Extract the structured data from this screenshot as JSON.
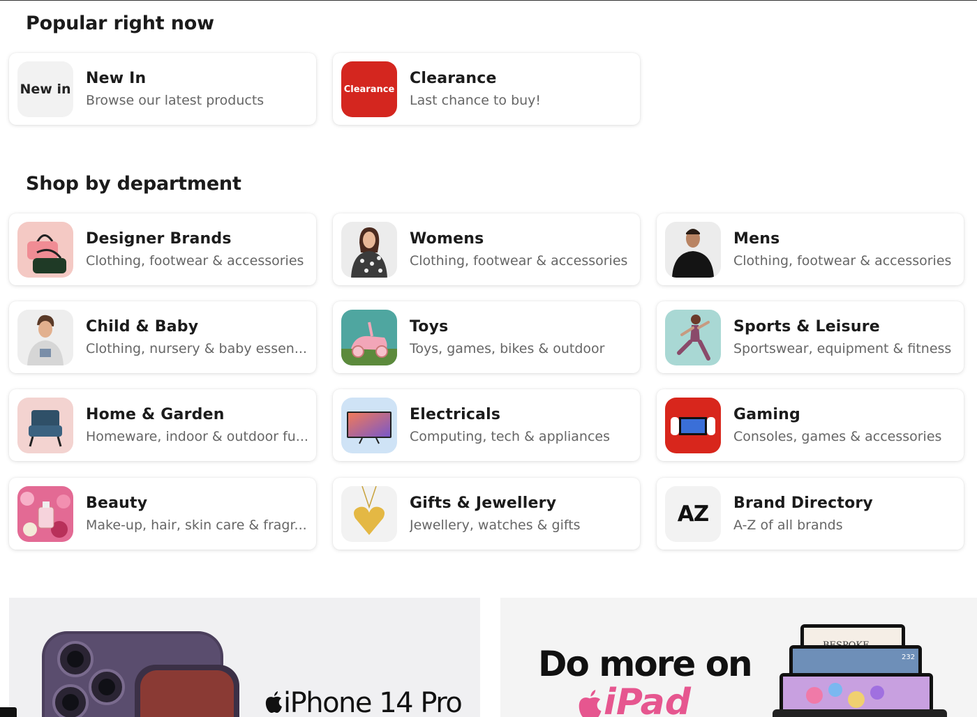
{
  "popular": {
    "title": "Popular right now",
    "items": [
      {
        "name": "New In",
        "desc": "Browse our latest products",
        "thumb_label": "New in"
      },
      {
        "name": "Clearance",
        "desc": "Last chance to buy!",
        "thumb_label": "Clearance"
      }
    ]
  },
  "departments": {
    "title": "Shop by department",
    "items": [
      {
        "name": "Designer Brands",
        "desc": "Clothing, footwear & accessories",
        "icon": "handbag-icon"
      },
      {
        "name": "Womens",
        "desc": "Clothing, footwear & accessories",
        "icon": "woman-model-icon"
      },
      {
        "name": "Mens",
        "desc": "Clothing, footwear & accessories",
        "icon": "man-model-icon"
      },
      {
        "name": "Child & Baby",
        "desc": "Clothing, nursery & baby essen...",
        "icon": "child-model-icon"
      },
      {
        "name": "Toys",
        "desc": "Toys, games, bikes & outdoor",
        "icon": "ride-on-toy-icon"
      },
      {
        "name": "Sports & Leisure",
        "desc": "Sportswear, equipment & fitness",
        "icon": "runner-icon"
      },
      {
        "name": "Home & Garden",
        "desc": "Homeware, indoor & outdoor fu...",
        "icon": "armchair-icon"
      },
      {
        "name": "Electricals",
        "desc": "Computing, tech & appliances",
        "icon": "tv-icon"
      },
      {
        "name": "Gaming",
        "desc": "Consoles, games & accessories",
        "icon": "game-console-icon"
      },
      {
        "name": "Beauty",
        "desc": "Make-up, hair, skin care & fragr...",
        "icon": "perfume-flowers-icon"
      },
      {
        "name": "Gifts & Jewellery",
        "desc": "Jewellery, watches & gifts",
        "icon": "heart-pendant-icon"
      },
      {
        "name": "Brand Directory",
        "desc": "A-Z of all brands",
        "thumb_label": "AZ"
      }
    ]
  },
  "banners": {
    "iphone": {
      "text": "iPhone 14 Pro"
    },
    "ipad": {
      "line1": "Do more on",
      "line2": "iPad",
      "screen_text": "BESPOKE",
      "badge": "232"
    }
  },
  "colors": {
    "clearance_red": "#d4261f",
    "ipad_pink": "#e6568f",
    "desc_grey": "#666666"
  }
}
